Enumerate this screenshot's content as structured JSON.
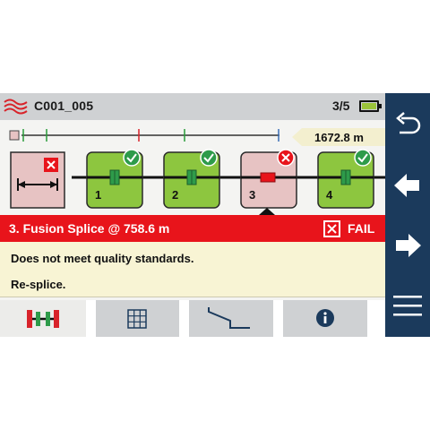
{
  "header": {
    "title": "C001_005",
    "count": "3/5"
  },
  "trace": {
    "distance": "1672.8 m"
  },
  "events": [
    {
      "number": "1",
      "status": "pass"
    },
    {
      "number": "2",
      "status": "pass"
    },
    {
      "number": "3",
      "status": "fail"
    },
    {
      "number": "4",
      "status": "pass"
    }
  ],
  "result": {
    "title": "3. Fusion Splice @ 758.6 m",
    "status_label": "FAIL",
    "message": "Does not meet quality standards.",
    "action": "Re-splice."
  },
  "tabs": [
    "events-icon",
    "table-icon",
    "trace-icon",
    "info-icon"
  ],
  "nav": [
    "undo-icon",
    "arrow-left-icon",
    "arrow-right-icon",
    "menu-icon"
  ],
  "colors": {
    "pass": "#8dc63f",
    "fail": "#e8141b",
    "nav": "#1b3a5c",
    "selected": "#e7c3c3"
  }
}
